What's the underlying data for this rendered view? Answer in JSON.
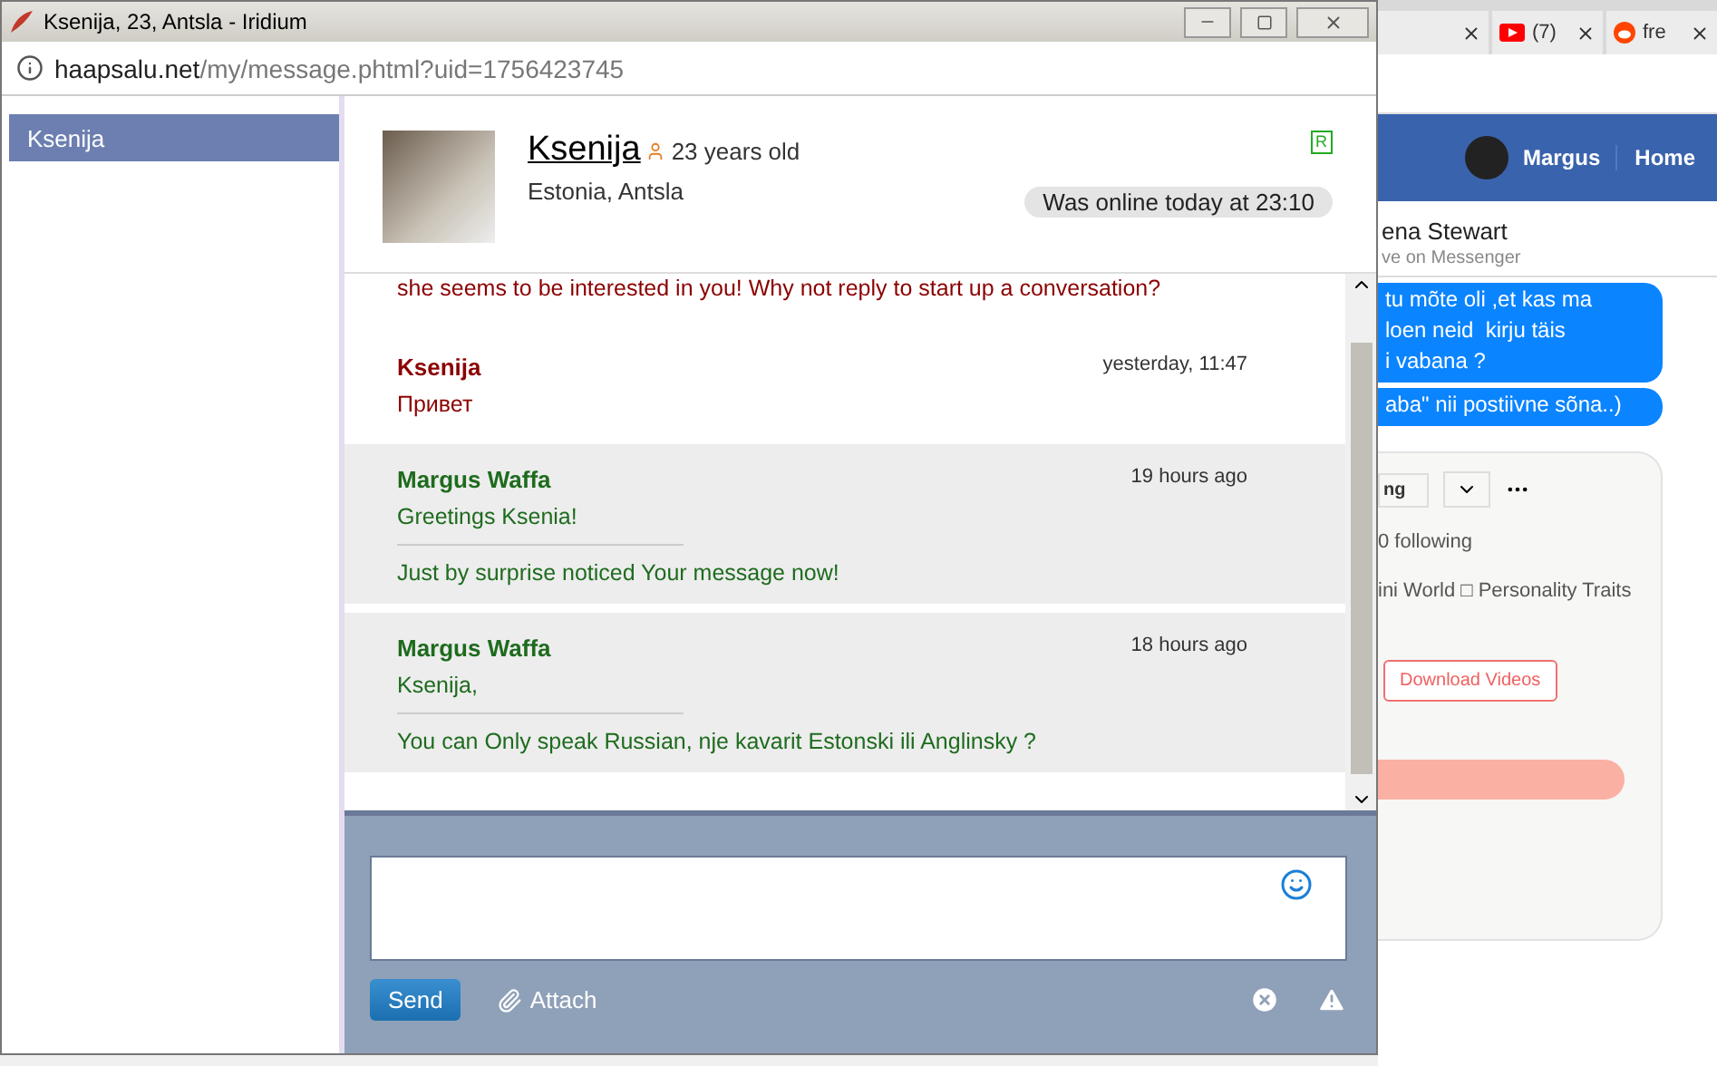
{
  "window": {
    "title": "Ksenija, 23, Antsla - Iridium",
    "url_host": "haapsalu.net",
    "url_path": "/my/message.phtml?uid=1756423745"
  },
  "sidebar": {
    "items": [
      {
        "label": "Ksenija",
        "selected": true
      }
    ]
  },
  "profile": {
    "name": "Ksenija",
    "age": "23 years old",
    "location": "Estonia, Antsla",
    "badge": "R",
    "last_seen": "Was online today at 23:10"
  },
  "messages": [
    {
      "kind": "notice",
      "text": "she seems to be interested in you! Why not reply to start up a conversation?"
    },
    {
      "kind": "incoming",
      "author": "Ksenija",
      "time": "yesterday, 11:47",
      "paragraphs": [
        "Привет"
      ]
    },
    {
      "kind": "outgoing",
      "author": "Margus Waffa",
      "time": "19 hours ago",
      "paragraphs": [
        "Greetings Ksenia!",
        "Just by surprise noticed Your message now!"
      ]
    },
    {
      "kind": "outgoing",
      "author": "Margus Waffa",
      "time": "18 hours ago",
      "paragraphs": [
        "Ksenija,",
        "You can Only speak Russian, nje kavarit Estonski ili Anglinsky ?"
      ]
    }
  ],
  "composer": {
    "send": "Send",
    "attach": "Attach"
  },
  "background": {
    "tabs": [
      {
        "kind": "plain"
      },
      {
        "kind": "video",
        "label": "(7)"
      },
      {
        "kind": "forum",
        "label": "fre"
      }
    ],
    "header": {
      "user": "Margus",
      "home": "Home"
    },
    "chat": {
      "name": "ena Stewart",
      "status": "ve on Messenger",
      "bubbles": [
        {
          "lines": [
            "tu mõte oli ,et kas ma",
            "loen neid  kirju täis",
            "i vabana ?"
          ]
        },
        {
          "lines": [
            "aba\" nii postiivne sõna..)"
          ]
        }
      ]
    },
    "card": {
      "button_fragment": "ng",
      "following": "0 following",
      "tags": "ini World □ Personality Traits",
      "download": "Download Videos"
    }
  }
}
